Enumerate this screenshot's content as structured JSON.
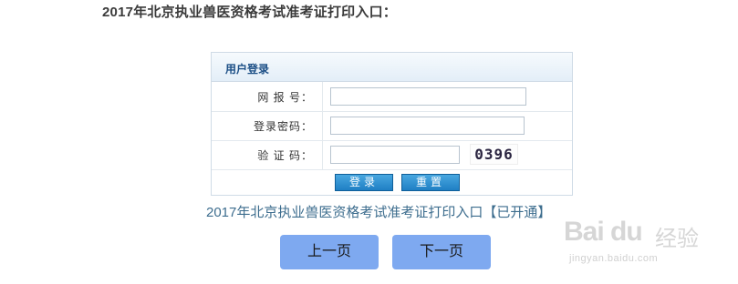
{
  "heading": "2017年北京执业兽医资格考试准考证打印入口：",
  "login_box": {
    "title": "用户登录",
    "rows": [
      {
        "label": "网 报 号："
      },
      {
        "label": "登录密码："
      },
      {
        "label": "验 证 码："
      }
    ],
    "captcha_value": "0396",
    "login_button": "登录",
    "reset_button": "重置"
  },
  "link_text": "2017年北京执业兽医资格考试准考证打印入口【已开通】",
  "nav": {
    "prev": "上一页",
    "next": "下一页"
  },
  "watermark": {
    "logo": "Bai du",
    "text": "经验",
    "url": "jingyan.baidu.com"
  },
  "colors": {
    "button_blue": "#1f7fc4",
    "nav_button": "#7ea9f0",
    "title_blue": "#1c4f86",
    "link_color": "#3d6d8e"
  }
}
